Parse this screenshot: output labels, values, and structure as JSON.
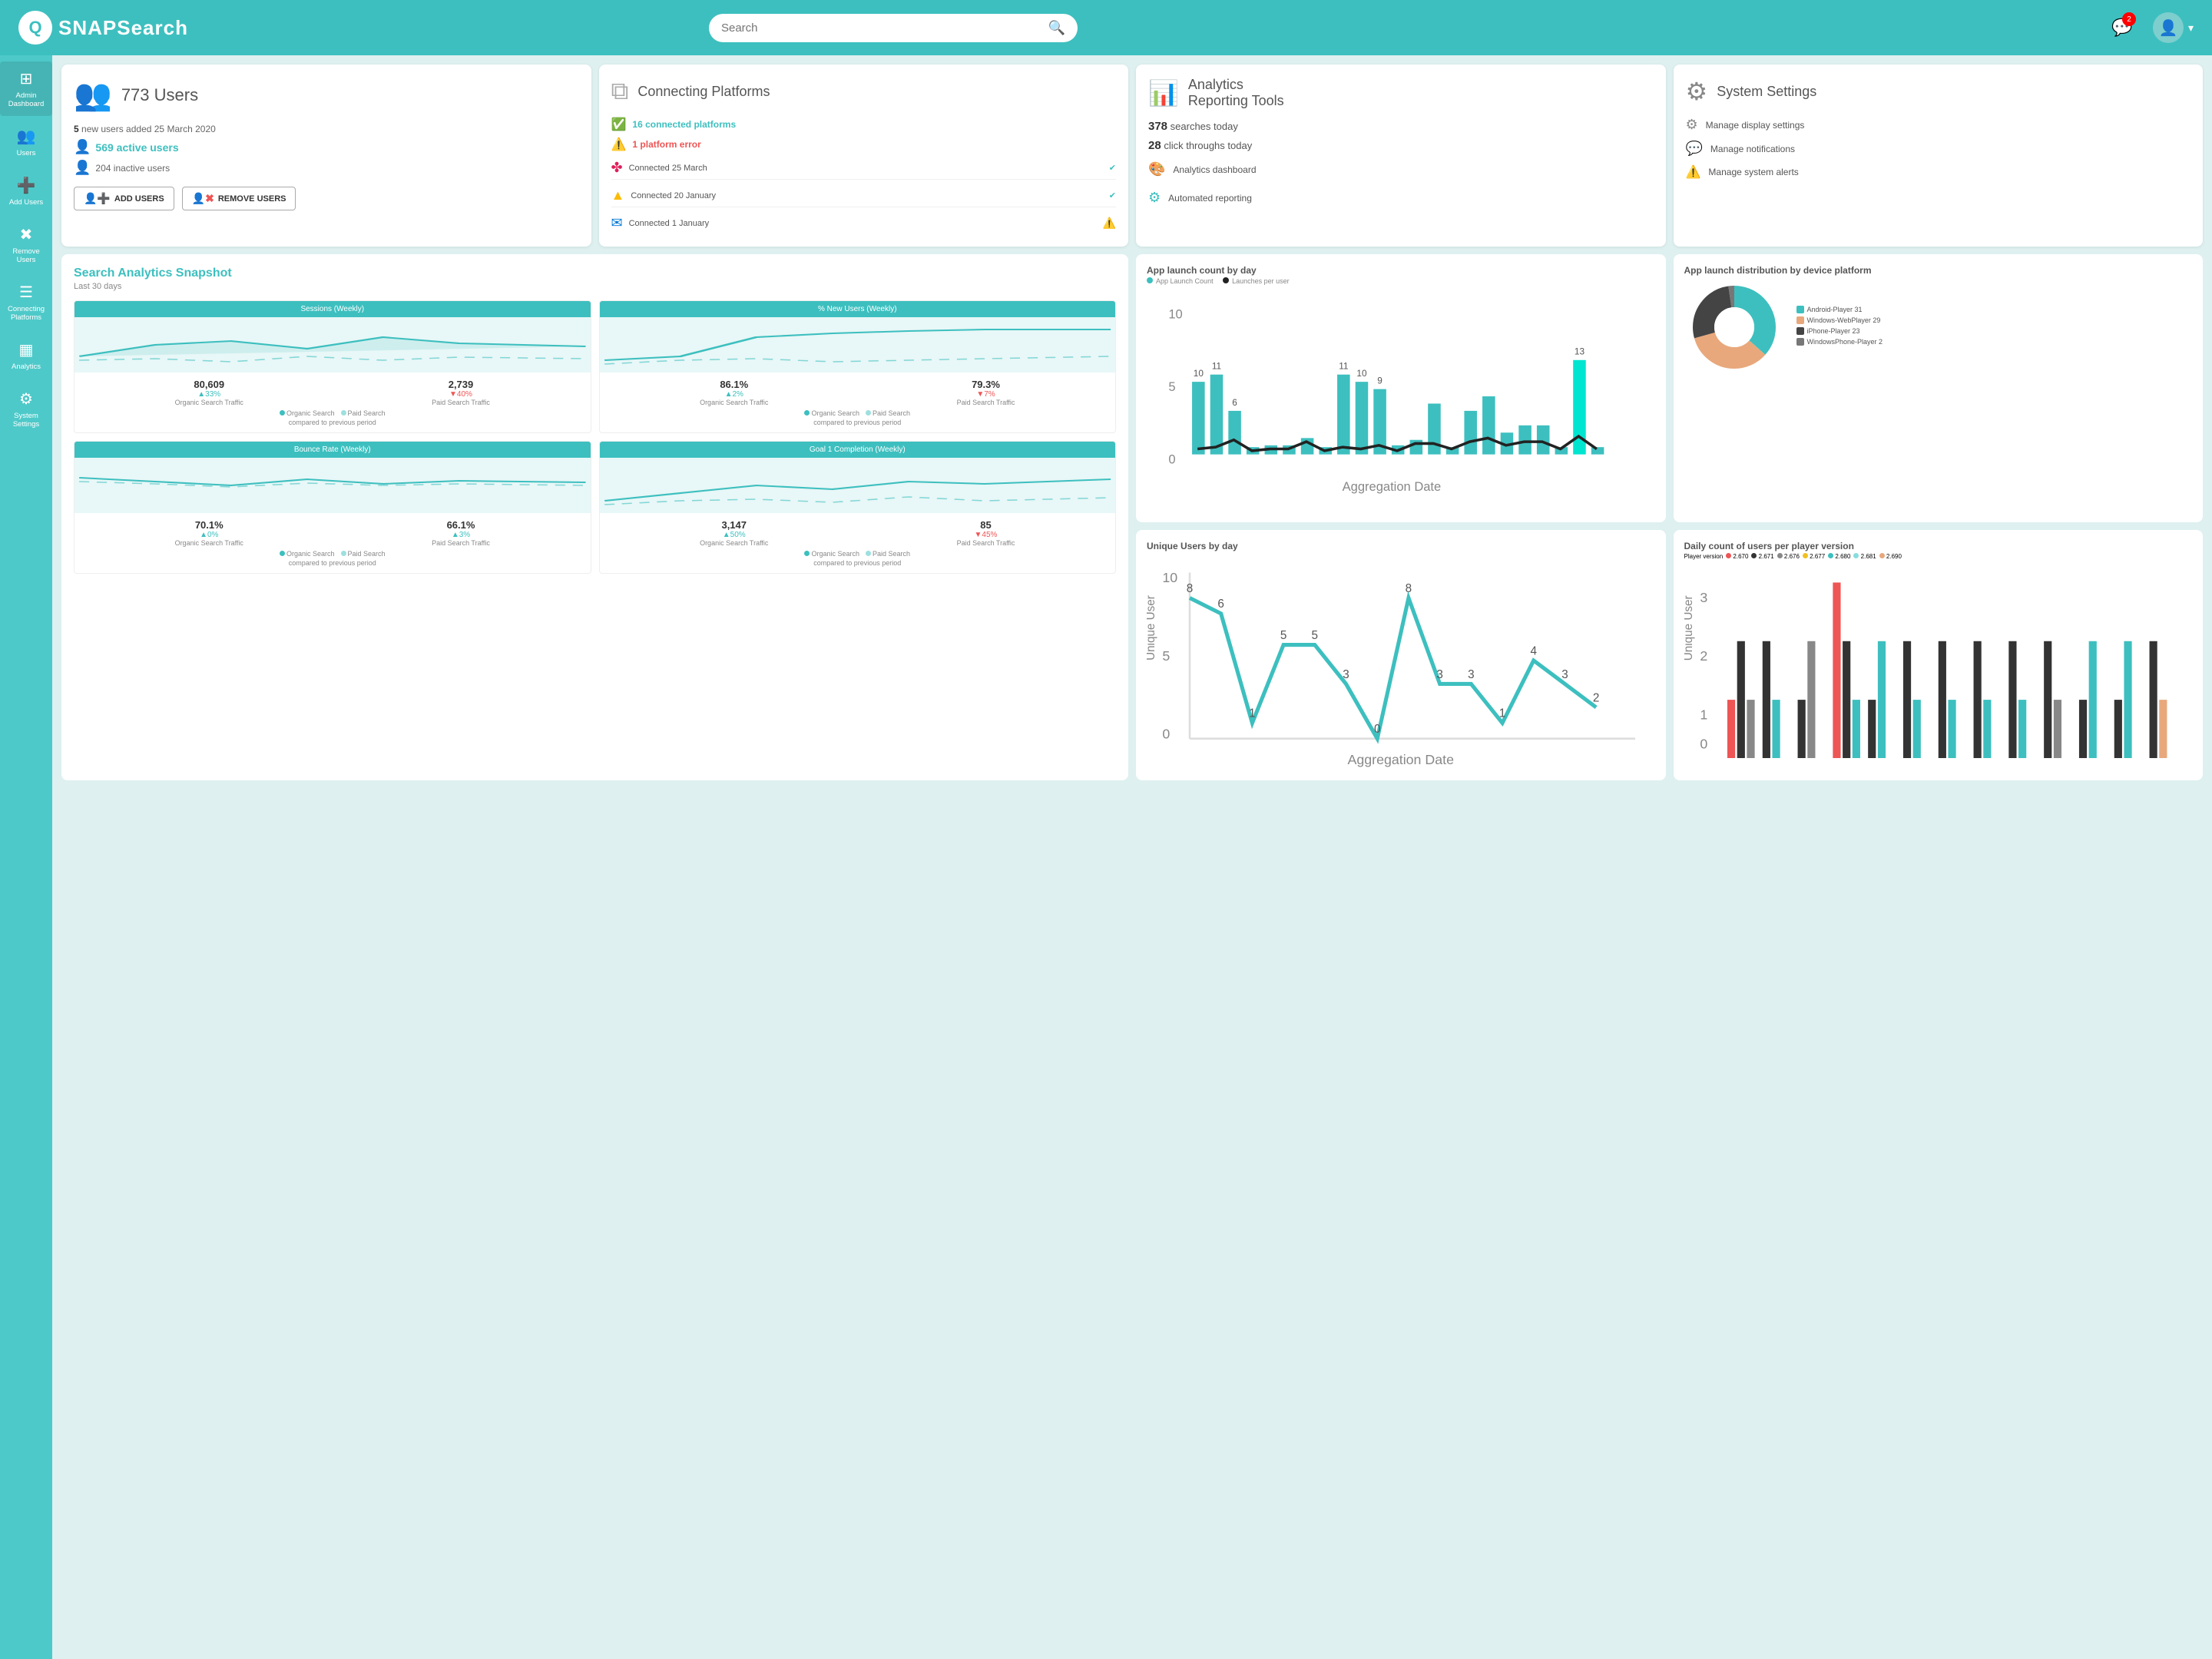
{
  "header": {
    "logo_text": "SNAPSearch",
    "search_placeholder": "Search",
    "notif_count": "2"
  },
  "sidebar": {
    "items": [
      {
        "label": "Admin\nDashboard",
        "icon": "⊞"
      },
      {
        "label": "Users",
        "icon": "👥"
      },
      {
        "label": "Add Users",
        "icon": "➕"
      },
      {
        "label": "Remove Users",
        "icon": "❌"
      },
      {
        "label": "Connecting\nPlatforms",
        "icon": "☰"
      },
      {
        "label": "Analytics",
        "icon": "▦"
      },
      {
        "label": "System\nSettings",
        "icon": "⚙"
      }
    ]
  },
  "users_card": {
    "count": "773 Users",
    "new_users_text": "5 new users added 25 March 2020",
    "active_users": "569 active users",
    "inactive_users": "204 inactive users",
    "btn_add": "ADD USERS",
    "btn_remove": "REMOVE USERS"
  },
  "platforms_card": {
    "title": "Connecting Platforms",
    "connected_count": "16 connected platforms",
    "error_count": "1 platform error",
    "platforms": [
      {
        "name": "Slack",
        "status": "Connected 25 March",
        "ok": true
      },
      {
        "name": "Drive",
        "status": "Connected 20 January",
        "ok": true
      },
      {
        "name": "Outlook",
        "status": "Connected 1 January",
        "ok": false
      }
    ]
  },
  "analytics_card": {
    "title": "Analytics\nReporting Tools",
    "searches_today": "378",
    "searches_label": "searches today",
    "clicks_today": "28",
    "clicks_label": "click throughs today",
    "link1": "Analytics dashboard",
    "link2": "Automated reporting"
  },
  "settings_card": {
    "title": "System Settings",
    "link1": "Manage display settings",
    "link2": "Manage notifications",
    "link3": "Manage system alerts"
  },
  "search_analytics": {
    "title": "Search Analytics Snapshot",
    "subtitle": "Last 30 days",
    "charts": [
      {
        "title": "Sessions (Weekly)",
        "val1": "80,609",
        "val2": "2,739",
        "delta1": "▲33%",
        "delta2": "▼40%",
        "label1": "Organic Search Traffic",
        "label2": "Paid Search Traffic",
        "delta1_up": true,
        "delta2_up": false
      },
      {
        "title": "% New Users (Weekly)",
        "val1": "86.1%",
        "val2": "79.3%",
        "delta1": "▲2%",
        "delta2": "▼7%",
        "label1": "Organic Search Traffic",
        "label2": "Paid Search Traffic",
        "delta1_up": true,
        "delta2_up": false
      },
      {
        "title": "Bounce Rate (Weekly)",
        "val1": "70.1%",
        "val2": "66.1%",
        "delta1": "▲0%",
        "delta2": "▲3%",
        "label1": "Organic Search Traffic",
        "label2": "Paid Search Traffic",
        "delta1_up": true,
        "delta2_up": true
      },
      {
        "title": "Goal 1 Completion (Weekly)",
        "val1": "3,147",
        "val2": "85",
        "delta1": "▲50%",
        "delta2": "▼45%",
        "label1": "Organic Search Traffic",
        "label2": "Paid Search Traffic",
        "delta1_up": true,
        "delta2_up": false
      }
    ]
  },
  "app_launch_chart": {
    "title": "App launch count by day",
    "legend1": "App Launch Count",
    "legend2": "Launches per user"
  },
  "distribution_chart": {
    "title": "App launch distribution by device platform",
    "segments": [
      {
        "label": "Android-Player 31",
        "color": "#3dbfbf",
        "value": 31
      },
      {
        "label": "Windows-WebPlayer 29",
        "color": "#e8a87c",
        "value": 29
      },
      {
        "label": "iPhone-Player 23",
        "color": "#555",
        "value": 23
      },
      {
        "label": "WindowsPhone-Player 2",
        "color": "#777",
        "value": 2
      }
    ]
  },
  "unique_users_chart": {
    "title": "Unique Users by day"
  },
  "daily_count_chart": {
    "title": "Daily count of users per player version",
    "versions": [
      "2.670",
      "2.671",
      "2.676",
      "2.677",
      "2.680",
      "2.681",
      "2.690"
    ],
    "colors": [
      "#e55",
      "#333",
      "#888",
      "#f0c020",
      "#3dbfbf",
      "#8dd",
      "#e8a87c"
    ]
  },
  "colors": {
    "primary": "#3dbfbf",
    "accent": "#e55",
    "sidebar": "#4ec9c9",
    "header": "#3dbfbf"
  }
}
